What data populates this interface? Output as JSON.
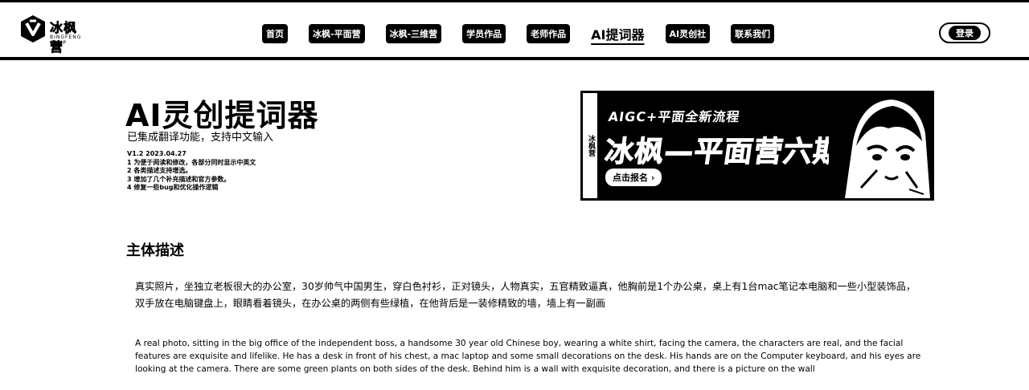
{
  "header": {
    "logo_text": "冰枫营",
    "logo_subtext": "BINGFENG CAMP",
    "nav_items": [
      {
        "label": "首页",
        "active": false
      },
      {
        "label": "冰枫-平面营",
        "active": false
      },
      {
        "label": "冰枫-三维营",
        "active": false
      },
      {
        "label": "学员作品",
        "active": false
      },
      {
        "label": "老师作品",
        "active": false
      },
      {
        "label": "AI提词器",
        "active": true
      },
      {
        "label": "AI灵创社",
        "active": false
      },
      {
        "label": "联系我们",
        "active": false
      }
    ],
    "login_label": "登录"
  },
  "main": {
    "title": "AI灵创提词器",
    "subtitle": "已集成翻译功能，支持中文输入",
    "version_lines": [
      "V1.2 2023.04.27",
      "1 为便于阅读和修改，各部分同时显示中英文",
      "2 各类描述支持增选。",
      "3 增加了几个补充描述和官方参数。",
      "4 修复一些bug和优化操作逻辑"
    ]
  },
  "banner": {
    "side_label": "冰枫营",
    "line1": "AIGC+平面全新流程",
    "line2": "冰枫—平面营六期",
    "cta_label": "点击报名 ›",
    "icon": "anime-character-illustration"
  },
  "description": {
    "heading": "主体描述",
    "chinese": "真实照片，坐独立老板很大的办公室，30岁帅气中国男生，穿白色衬衫，正对镜头，人物真实，五官精致逼真，他胸前是1个办公桌，桌上有1台mac笔记本电脑和一些小型装饰品，双手放在电脑键盘上，眼睛看着镜头，在办公桌的两侧有些绿植，在他背后是一装修精致的墙，墙上有一副画",
    "english": "A real photo, sitting in the big office of the independent boss, a handsome 30 year old Chinese boy, wearing a white shirt, facing the camera, the characters are real, and the facial features are exquisite and lifelike. He has a desk in front of his chest, a mac laptop and some small decorations on the desk. His hands are on the Computer keyboard, and his eyes are looking at the camera. There are some green plants on both sides of the desk. Behind him is a wall with exquisite decoration, and there is a picture on the wall"
  }
}
